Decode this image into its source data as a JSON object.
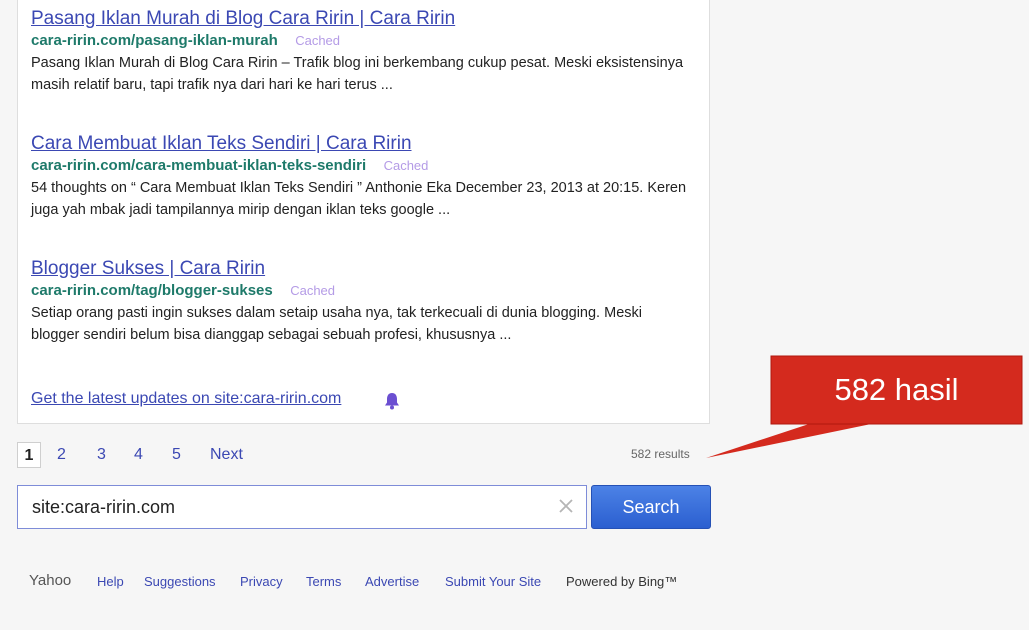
{
  "results": [
    {
      "title": "Pasang Iklan Murah di Blog Cara Ririn | Cara Ririn",
      "url": "cara-ririn.com/pasang-iklan-murah",
      "cached": "Cached",
      "snippet": "Pasang Iklan Murah di Blog Cara Ririn – Trafik blog ini berkembang cukup pesat. Meski eksistensinya masih relatif baru, tapi trafik nya dari hari ke hari terus ..."
    },
    {
      "title": "Cara Membuat Iklan Teks Sendiri | Cara Ririn",
      "url": "cara-ririn.com/cara-membuat-iklan-teks-sendiri",
      "cached": "Cached",
      "snippet": "54 thoughts on “ Cara Membuat Iklan Teks Sendiri ” Anthonie Eka December 23, 2013 at 20:15. Keren juga yah mbak jadi tampilannya mirip dengan iklan teks google ..."
    },
    {
      "title": "Blogger Sukses | Cara Ririn",
      "url": "cara-ririn.com/tag/blogger-sukses",
      "cached": "Cached",
      "snippet": "Setiap orang pasti ingin sukses dalam setaip usaha nya, tak terkecuali di dunia blogging. Meski blogger sendiri belum bisa dianggap sebagai sebuah profesi, khususnya ..."
    }
  ],
  "updates_link": "Get the latest updates on site:cara-ririn.com",
  "pagination": {
    "pages": [
      "1",
      "2",
      "3",
      "4",
      "5"
    ],
    "current": "1",
    "next": "Next"
  },
  "result_count": "582 results",
  "search": {
    "query": "site:cara-ririn.com",
    "button_label": "Search"
  },
  "footer": {
    "brand": "Yahoo",
    "links": [
      "Help",
      "Suggestions",
      "Privacy",
      "Terms",
      "Advertise",
      "Submit Your Site"
    ],
    "powered_by": "Powered by Bing™"
  },
  "callout": {
    "text": "582 hasil",
    "color": "#d42a1e"
  },
  "colors": {
    "link": "#3b48b3",
    "url": "#1e7a6a",
    "cached": "#b49be6",
    "button": "#2b5fd0"
  }
}
